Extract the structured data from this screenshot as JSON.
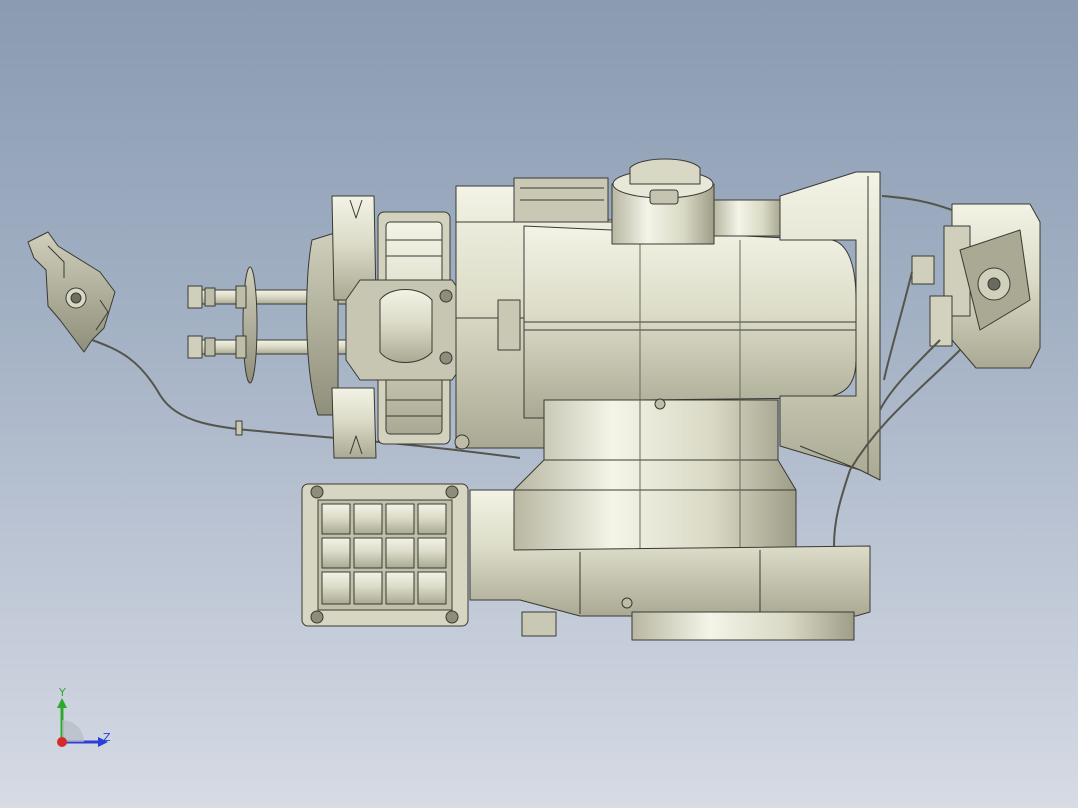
{
  "viewport": {
    "background_top": "#8a9bb2",
    "background_bottom": "#d6dbe4",
    "model_fill": "#e4e4d4",
    "model_shade": "#b9b9a4",
    "edge_color": "#3a3a34"
  },
  "triad": {
    "y_label": "Y",
    "z_label": "Z",
    "y_color": "#2fa82f",
    "z_color": "#2a3fd6",
    "x_color": "#d62a2a"
  }
}
